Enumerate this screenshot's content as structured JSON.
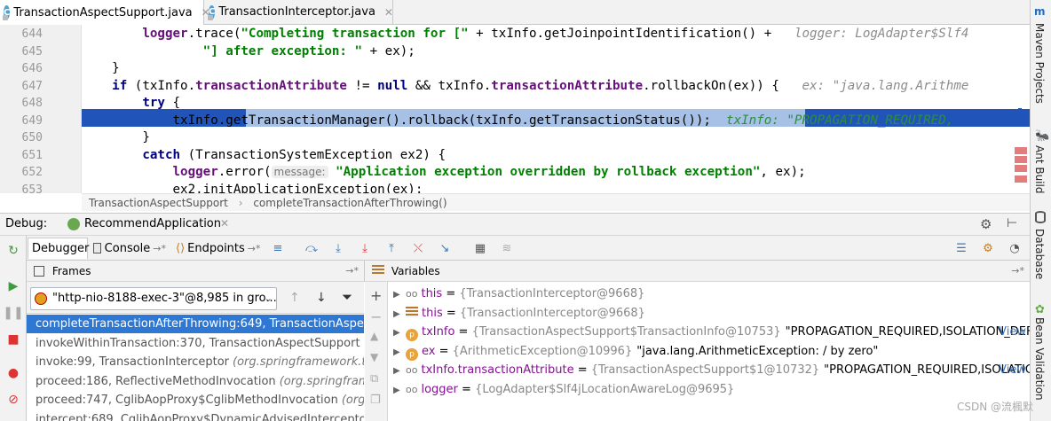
{
  "tabs": [
    {
      "label": "TransactionAspectSupport.java",
      "icon": "class-c-icon",
      "active": true
    },
    {
      "label": "TransactionInterceptor.java",
      "icon": "class-c-icon",
      "active": false
    }
  ],
  "editor": {
    "line_numbers": [
      "644",
      "645",
      "646",
      "647",
      "648",
      "649",
      "650",
      "651",
      "652",
      "653"
    ],
    "lines": [
      [
        [
          "fld",
          "        logger"
        ],
        [
          "",
          "."
        ],
        [
          "",
          "trace("
        ],
        [
          "str",
          "\"Completing transaction for [\""
        ],
        [
          "",
          " + txInfo.getJoinpointIdentification() + "
        ],
        [
          "ghost",
          "  logger: LogAdapter$Slf4"
        ]
      ],
      [
        [
          "",
          ""
        ],
        [
          "str",
          "                \"] after exception: \""
        ],
        [
          "",
          " + ex);"
        ]
      ],
      [
        [
          "",
          "    }"
        ]
      ],
      [
        [
          "kw",
          "    if"
        ],
        [
          "",
          " (txInfo."
        ],
        [
          "fld",
          "transactionAttribute"
        ],
        [
          "",
          " != "
        ],
        [
          "kw",
          "null"
        ],
        [
          "",
          " && txInfo."
        ],
        [
          "fld",
          "transactionAttribute"
        ],
        [
          "",
          ".rollbackOn(ex)) {"
        ],
        [
          "ghost",
          "   ex: \"java.lang.Arithme"
        ]
      ],
      [
        [
          "kw",
          "        try"
        ],
        [
          "",
          " {"
        ]
      ],
      [
        [
          "",
          "            txInfo.getTransactionManager().rollback(txInfo.getTransactionStatus());"
        ],
        [
          "ghost2",
          "  txInfo: \"PROPAGATION_REQUIRED,"
        ]
      ],
      [
        [
          "",
          "        }"
        ]
      ],
      [
        [
          "kw",
          "        catch"
        ],
        [
          "",
          " (TransactionSystemException ex2) {"
        ]
      ],
      [
        [
          "fld",
          "            logger"
        ],
        [
          "",
          ".error("
        ],
        [
          "hint",
          "message:"
        ],
        [
          "str",
          " \"Application exception overridden by rollback exception\""
        ],
        [
          "",
          ", ex);"
        ]
      ],
      [
        [
          "",
          "            ex2.initApplicationException(ex);"
        ]
      ]
    ],
    "breadcrumb": [
      "TransactionAspectSupport",
      "completeTransactionAfterThrowing()"
    ]
  },
  "right_tools": [
    "Maven Projects",
    "Ant Build",
    "Database",
    "Bean Validation"
  ],
  "debug": {
    "label": "Debug:",
    "config": "RecommendApplication",
    "tabs": [
      "Debugger",
      "Console",
      "Endpoints"
    ]
  },
  "frames": {
    "title": "Frames",
    "thread": "\"http-nio-8188-exec-3\"@8,985 in gro...",
    "items": [
      {
        "method": "completeTransactionAfterThrowing:649,",
        "cls": "TransactionAspectSup",
        "selected": true
      },
      {
        "method": "invokeWithinTransaction:370,",
        "cls": "TransactionAspectSupport",
        "pkg": "(org.s"
      },
      {
        "method": "invoke:99,",
        "cls": "TransactionInterceptor",
        "pkg": "(org.springframework.transa"
      },
      {
        "method": "proceed:186,",
        "cls": "ReflectiveMethodInvocation",
        "pkg": "(org.springframewo"
      },
      {
        "method": "proceed:747,",
        "cls": "CglibAopProxy$CglibMethodInvocation",
        "pkg": "(org.spri"
      },
      {
        "method": "intercept:689,",
        "cls": "CglibAopProxy$DynamicAdvisedInterceptor",
        "pkg": "(org.s"
      }
    ]
  },
  "variables": {
    "title": "Variables",
    "items": [
      {
        "kind": "oo",
        "name": "this",
        "value": "{TransactionInterceptor@9668}",
        "extra": "",
        "view": ""
      },
      {
        "kind": "field",
        "name": "this",
        "value": "{TransactionInterceptor@9668}",
        "extra": "",
        "view": ""
      },
      {
        "kind": "param",
        "name": "txInfo",
        "value": "{TransactionAspectSupport$TransactionInfo@10753}",
        "extra": "\"PROPAGATION_REQUIRED,ISOLATION_DEFA...",
        "view": "View"
      },
      {
        "kind": "param",
        "name": "ex",
        "value": "{ArithmeticException@10996}",
        "extra": "\"java.lang.ArithmeticException: / by zero\"",
        "view": ""
      },
      {
        "kind": "oo",
        "name": "txInfo.transactionAttribute",
        "value": "{TransactionAspectSupport$1@10732}",
        "extra": "\"PROPAGATION_REQUIRED,ISOLATION...",
        "view": "View"
      },
      {
        "kind": "oo",
        "name": "logger",
        "value": "{LogAdapter$Slf4jLocationAwareLog@9695}",
        "extra": "",
        "view": ""
      }
    ]
  },
  "watermark": "CSDN @流楓默"
}
